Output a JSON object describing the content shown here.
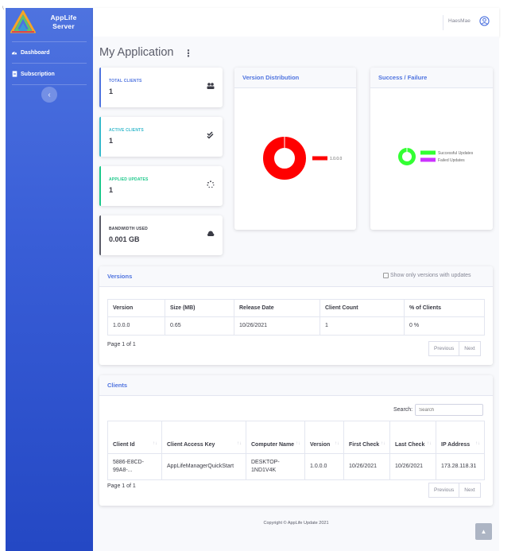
{
  "sidebar": {
    "brand_line1": "AppLife",
    "brand_line2": "Server",
    "items": [
      {
        "label": "Dashboard",
        "icon": "dashboard-icon"
      },
      {
        "label": "Subscription",
        "icon": "document-icon"
      }
    ],
    "toggle_glyph": "‹"
  },
  "topbar": {
    "username": "HaesMae",
    "icon": "user-circle-icon"
  },
  "page": {
    "title": "My Application",
    "menu_glyph": "⋮"
  },
  "stats": [
    {
      "label": "TOTAL CLIENTS",
      "value": "1",
      "color": "#4e73df",
      "icon": "users-icon"
    },
    {
      "label": "ACTIVE CLIENTS",
      "value": "1",
      "color": "#36b9cc",
      "icon": "check-double-icon"
    },
    {
      "label": "APPLIED UPDATES",
      "value": "1",
      "color": "#1cc88a",
      "icon": "spinner-icon"
    },
    {
      "label": "BANDWIDTH USED",
      "value": "0.001 GB",
      "color": "#5a5c69",
      "icon": "cloud-icon"
    }
  ],
  "version_distribution": {
    "title": "Version Distribution",
    "chart_data": {
      "type": "pie",
      "categories": [
        "1.0.0.0"
      ],
      "values": [
        100
      ],
      "colors": [
        "#ff0000"
      ],
      "legend_position": "right"
    }
  },
  "success_failure": {
    "title": "Success / Failure",
    "chart_data": {
      "type": "pie",
      "categories": [
        "Successful Updates",
        "Failed Updates"
      ],
      "values": [
        100,
        0
      ],
      "colors": [
        "#33ff33",
        "#cc33ff"
      ],
      "legend_position": "right"
    }
  },
  "versions": {
    "title": "Versions",
    "checkbox_label": "Show only versions with updates",
    "columns": [
      "Version",
      "Size (MB)",
      "Release Date",
      "Client Count",
      "% of Clients"
    ],
    "rows": [
      [
        "1.0.0.0",
        "0.65",
        "10/26/2021",
        "1",
        "0 %"
      ]
    ],
    "page_info": "Page 1 of 1",
    "prev_label": "Previous",
    "next_label": "Next"
  },
  "clients": {
    "title": "Clients",
    "search_label": "Search:",
    "search_placeholder": "Search",
    "columns": [
      "Client Id",
      "Client Access Key",
      "Computer Name",
      "Version",
      "First Check",
      "Last Check",
      "IP Address"
    ],
    "rows": [
      [
        "5886-E8CD-99A8-...",
        "AppLifeManagerQuickStart",
        "DESKTOP-1ND1V4K",
        "1.0.0.0",
        "10/26/2021",
        "10/26/2021",
        "173.28.118.31"
      ]
    ],
    "page_info": "Page 1 of 1",
    "prev_label": "Previous",
    "next_label": "Next"
  },
  "footer": {
    "text": "Copyright © AppLife Update 2021"
  },
  "scroll_top_glyph": "▲",
  "corner_mark": "\\"
}
